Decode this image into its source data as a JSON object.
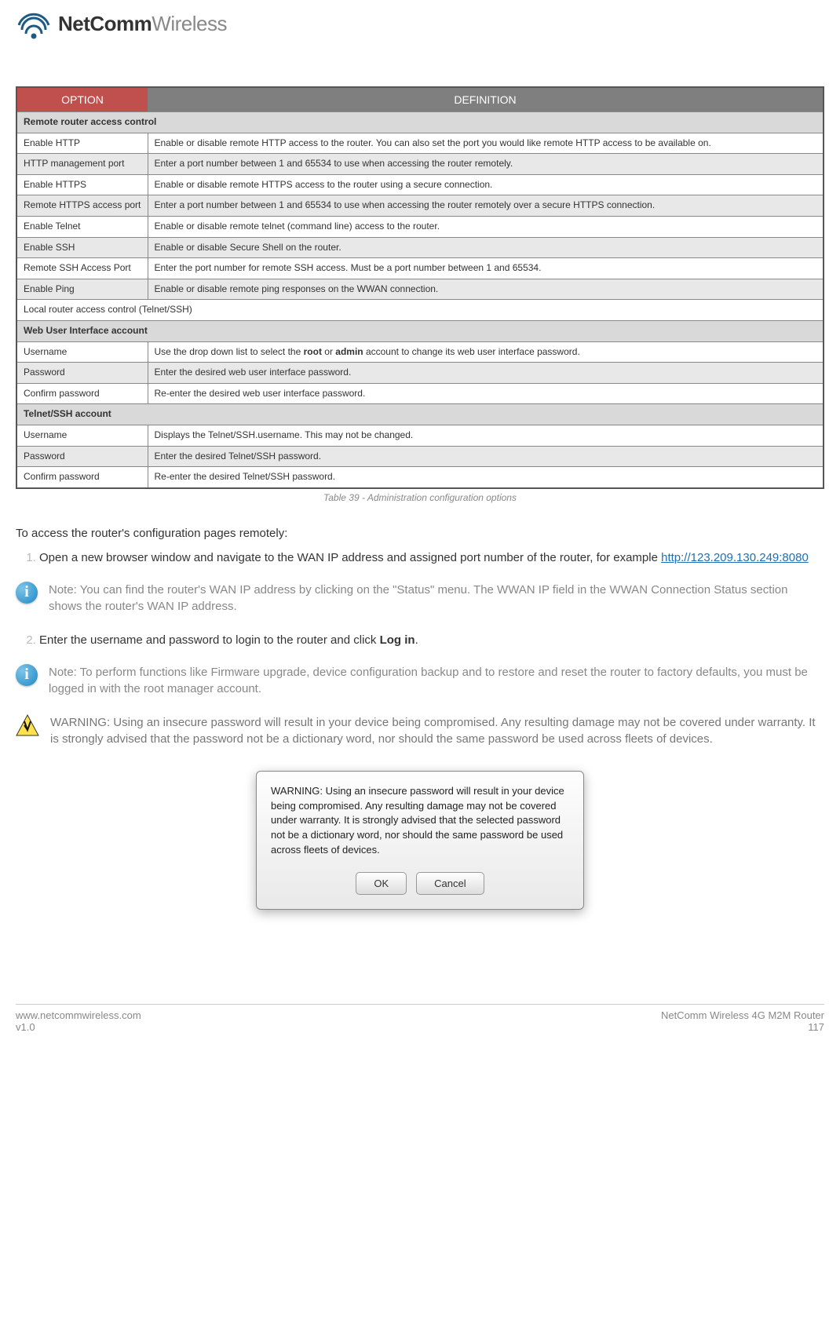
{
  "brand": {
    "bold": "NetComm",
    "light": "Wireless"
  },
  "table": {
    "headers": {
      "option": "OPTION",
      "definition": "DEFINITION"
    },
    "rows": [
      {
        "type": "section",
        "span": "Remote router access control"
      },
      {
        "type": "row",
        "opt": "Enable HTTP",
        "def": "Enable or disable remote HTTP access to the router. You can also set the port you would like remote HTTP access to be available on."
      },
      {
        "type": "row",
        "zebra": true,
        "opt": "HTTP management port",
        "def": "Enter a port number between 1 and 65534 to use when accessing the router remotely."
      },
      {
        "type": "row",
        "opt": "Enable HTTPS",
        "def": "Enable or disable remote HTTPS access to the router using a secure connection."
      },
      {
        "type": "row",
        "zebra": true,
        "opt": "Remote HTTPS access port",
        "def": "Enter a port number between 1 and 65534 to use when accessing the router remotely over a secure HTTPS connection."
      },
      {
        "type": "row",
        "opt": "Enable Telnet",
        "def": "Enable or disable remote telnet (command line) access to the router."
      },
      {
        "type": "row",
        "zebra": true,
        "opt": "Enable SSH",
        "def": "Enable or disable Secure Shell on the router."
      },
      {
        "type": "row",
        "opt": "Remote SSH Access Port",
        "def": "Enter the port number for remote SSH access. Must be a port number between 1 and 65534."
      },
      {
        "type": "row",
        "zebra": true,
        "opt": "Enable Ping",
        "def": "Enable or disable remote ping responses on the WWAN connection."
      },
      {
        "type": "section-plain",
        "span": "Local router access control (Telnet/SSH)"
      },
      {
        "type": "section",
        "span": "Web User Interface account"
      },
      {
        "type": "row",
        "opt": "Username",
        "def_pre": "Use the drop down list to select the ",
        "def_b1": "root",
        "def_mid": " or ",
        "def_b2": "admin",
        "def_post": " account to change its web user interface password."
      },
      {
        "type": "row",
        "zebra": true,
        "opt": "Password",
        "def": "Enter the desired web user interface password."
      },
      {
        "type": "row",
        "opt": "Confirm password",
        "def": "Re-enter the desired web user interface password."
      },
      {
        "type": "section",
        "span": "Telnet/SSH account"
      },
      {
        "type": "row",
        "opt": "Username",
        "def": "Displays the Telnet/SSH.username. This may not be changed."
      },
      {
        "type": "row",
        "zebra": true,
        "opt": "Password",
        "def": "Enter the desired Telnet/SSH password."
      },
      {
        "type": "row",
        "opt": "Confirm password",
        "def": "Re-enter the desired Telnet/SSH password."
      }
    ]
  },
  "caption": "Table 39 - Administration configuration options",
  "intro": "To access the router's configuration pages remotely:",
  "step1_pre": "Open a new browser window and navigate to the WAN IP address and assigned port number of the router, for example ",
  "step1_url": "http://123.209.130.249:8080",
  "note1": "Note: You can find the router's WAN IP address by clicking on the \"Status\" menu. The WWAN IP field in the WWAN Connection Status section shows the router's WAN IP address.",
  "step2_pre": "Enter the username and password to login to the router and click ",
  "step2_b": "Log in",
  "step2_post": ".",
  "note2": "Note: To perform functions like Firmware upgrade, device configuration backup and to restore and reset the router to factory defaults, you must be logged in with the root manager account.",
  "warning": "WARNING: Using an insecure password will result in your device being compromised. Any resulting damage may not be covered under warranty. It is strongly advised that the password not be a dictionary word, nor should the same password be used across fleets of devices.",
  "dialog": {
    "msg": "WARNING: Using an insecure password will result in your device being compromised. Any resulting damage may not be covered under warranty. It is strongly advised that the selected password not be a dictionary word, nor should the same password be used across fleets of devices.",
    "ok": "OK",
    "cancel": "Cancel"
  },
  "footer": {
    "url": "www.netcommwireless.com",
    "ver": "v1.0",
    "product": "NetComm Wireless 4G M2M Router",
    "page": "117"
  }
}
